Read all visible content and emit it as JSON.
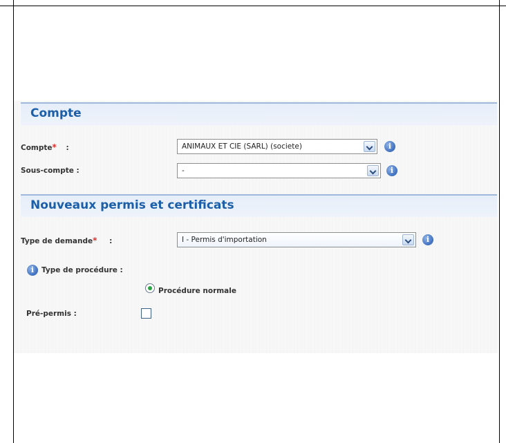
{
  "compte_section": {
    "title": "Compte",
    "compte_label": "Compte",
    "compte_value": "ANIMAUX ET CIE (SARL) (societe)",
    "sous_compte_label": "Sous-compte :",
    "sous_compte_value": "-",
    "colon": ":"
  },
  "permis_section": {
    "title": "Nouveaux permis et certificats",
    "type_demande_label": "Type de demande",
    "type_demande_value": "I - Permis d'importation",
    "type_procedure_label": "Type de procédure :",
    "procedure_option": "Procédure normale",
    "pre_permis_label": "Pré-permis :",
    "colon": ":"
  },
  "required_marker": "*",
  "info_glyph": "i",
  "colors": {
    "section_title": "#1c5fa8",
    "section_border": "#9fb7d9",
    "required": "#e0302a",
    "radio_selected": "#2aa341",
    "info_icon": "#3e6fbf"
  },
  "icons": [
    "info-icon",
    "chevron-down-icon",
    "radio-selected",
    "checkbox-unchecked"
  ]
}
